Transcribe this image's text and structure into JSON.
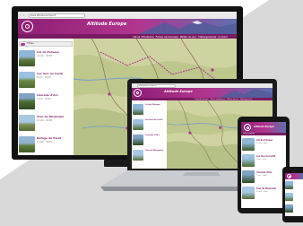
{
  "browser": {
    "url": "www.altiude.europe.fr"
  },
  "site": {
    "title": "Altitude Europe",
    "menu": [
      "Calcul d'itinéraire",
      "Fiches randonnées",
      "Météo du jour",
      "Hébergements",
      "Contact"
    ]
  },
  "listing": {
    "filter_label": "Filtres",
    "items": [
      {
        "title": "Col de Pelouse",
        "meta": "12 km · 4h30"
      },
      {
        "title": "Les lacs du Carlit",
        "meta": "9 km · 3h15"
      },
      {
        "title": "Cascade d'Ars",
        "meta": "7 km · 2h40"
      },
      {
        "title": "Tour du Montcalm",
        "meta": "15 km · 6h00"
      },
      {
        "title": "Refuge de Pinet",
        "meta": "11 km · 4h10"
      }
    ]
  },
  "colors": {
    "brand": "#8e1f74",
    "brand_dark": "#7a1a63",
    "header_end": "#5f6fae",
    "map_base": "#cfd3a0",
    "backdrop": "#d9d9d9"
  },
  "icons": {
    "logo": "spiral-logo-icon",
    "search": "search-icon"
  }
}
